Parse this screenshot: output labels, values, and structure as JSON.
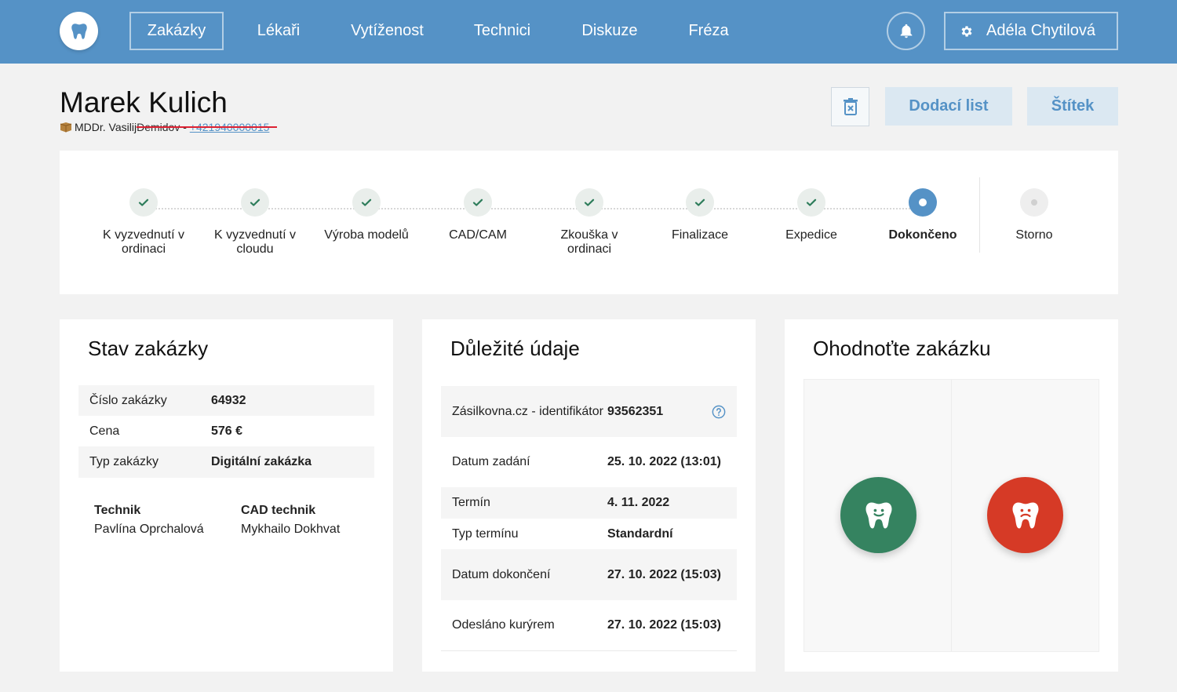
{
  "nav": {
    "items": [
      "Zakázky",
      "Lékaři",
      "Vytíženost",
      "Technici",
      "Diskuze",
      "Fréza"
    ],
    "user_name": "Adéla Chytilová"
  },
  "header": {
    "title": "Marek Kulich",
    "doctor": "MDDr. Vasilij ",
    "struck": "Demidov",
    "phone": "+421940000015",
    "delivery_note_label": "Dodací list",
    "label_button": "Štítek"
  },
  "stepper": {
    "steps": [
      {
        "label": "K vyzvednutí v ordinaci",
        "state": "done"
      },
      {
        "label": "K vyzvednutí v cloudu",
        "state": "done"
      },
      {
        "label": "Výroba modelů",
        "state": "done"
      },
      {
        "label": "CAD/CAM",
        "state": "done"
      },
      {
        "label": "Zkouška v ordinaci",
        "state": "done"
      },
      {
        "label": "Finalizace",
        "state": "done"
      },
      {
        "label": "Expedice",
        "state": "done"
      },
      {
        "label": "Dokončeno",
        "state": "current"
      },
      {
        "label": "Storno",
        "state": "pending"
      }
    ]
  },
  "status_card": {
    "title": "Stav zakázky",
    "rows": [
      {
        "key": "Číslo zakázky",
        "value": "64932"
      },
      {
        "key": "Cena",
        "value": "576 €"
      },
      {
        "key": "Typ zakázky",
        "value": "Digitální zakázka"
      }
    ],
    "technician_label": "Technik",
    "technician_name": "Pavlína Oprchalová",
    "cad_label": "CAD technik",
    "cad_name": "Mykhailo Dokhvat"
  },
  "info_card": {
    "title": "Důležité údaje",
    "rows": [
      {
        "key": "Zásilkovna.cz - identifikátor",
        "value": "93562351"
      },
      {
        "key": "Datum zadání",
        "value": "25. 10. 2022 (13:01)"
      },
      {
        "key": "Termín",
        "value": "4. 11. 2022"
      },
      {
        "key": "Typ termínu",
        "value": "Standardní"
      },
      {
        "key": "Datum dokončení",
        "value": "27. 10. 2022 (15:03)"
      },
      {
        "key": "Odesláno kurýrem",
        "value": "27. 10. 2022 (15:03)"
      }
    ]
  },
  "rating_card": {
    "title": "Ohodnoťte zakázku"
  },
  "colors": {
    "nav": "#5592c6",
    "check": "#2e7d5b",
    "good": "#358360",
    "bad": "#d63a26"
  }
}
